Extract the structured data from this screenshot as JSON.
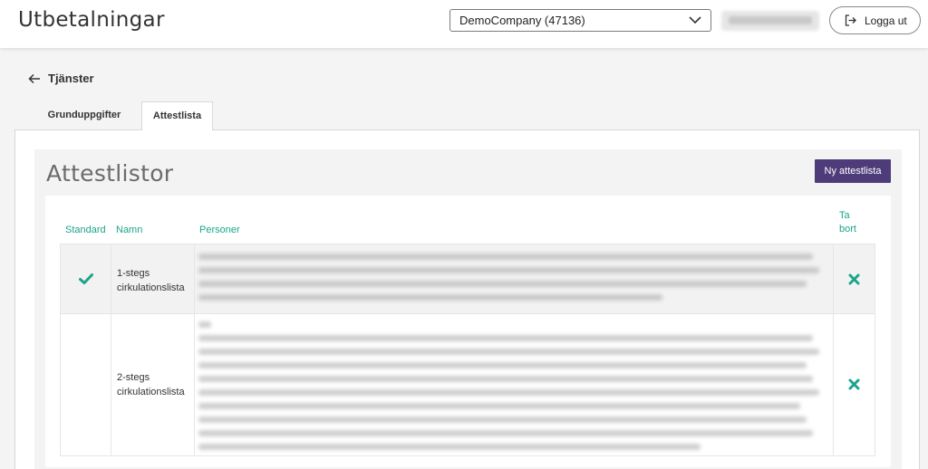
{
  "header": {
    "title": "Utbetalningar",
    "company_select": "DemoCompany (47136)",
    "logout_label": "Logga ut"
  },
  "nav": {
    "back_label": "Tjänster"
  },
  "tabs": [
    {
      "label": "Grunduppgifter",
      "active": false
    },
    {
      "label": "Attestlista",
      "active": true
    }
  ],
  "section": {
    "title": "Attestlistor",
    "new_button_label": "Ny attestlista"
  },
  "table": {
    "headers": {
      "standard": "Standard",
      "namn": "Namn",
      "personer": "Personer",
      "ta_bort": "Ta bort"
    },
    "rows": [
      {
        "name_line1": "1-stegs",
        "name_line2": "cirkulationslista",
        "standard": true
      },
      {
        "name_line1": "2-stegs",
        "name_line2": "cirkulationslista",
        "standard": false
      }
    ]
  },
  "colors": {
    "accent_teal": "#1aa58a",
    "primary_purple": "#4d3c79"
  },
  "icons": {
    "standard_check": "check-icon",
    "delete": "x-icon",
    "back": "arrow-left-icon",
    "logout": "logout-icon",
    "dropdown": "chevron-down-icon"
  }
}
